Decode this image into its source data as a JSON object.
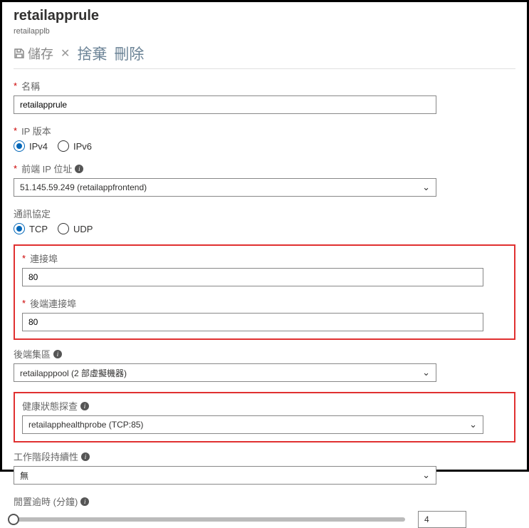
{
  "header": {
    "title": "retailapprule",
    "subtitle": "retailapplb"
  },
  "toolbar": {
    "save_label": "儲存",
    "discard_label": "捨棄",
    "delete_label": "刪除"
  },
  "name": {
    "label": "名稱",
    "value": "retailapprule"
  },
  "ip_version": {
    "label": "IP 版本",
    "ipv4": "IPv4",
    "ipv6": "IPv6"
  },
  "frontend_ip": {
    "label": "前端 IP 位址",
    "value": "51.145.59.249 (retailappfrontend)"
  },
  "protocol": {
    "label": "通訊協定",
    "tcp": "TCP",
    "udp": "UDP"
  },
  "port": {
    "label": "連接埠",
    "value": "80"
  },
  "backend_port": {
    "label": "後端連接埠",
    "value": "80"
  },
  "backend_pool": {
    "label": "後端集區",
    "value": "retailapppool (2 部虛擬機器)"
  },
  "health_probe": {
    "label": "健康狀態探查",
    "value": "retailapphealthprobe (TCP:85)"
  },
  "session_persistence": {
    "label": "工作階段持續性",
    "value": "無"
  },
  "idle_timeout": {
    "label": "閒置逾時 (分鐘)",
    "value": "4"
  }
}
